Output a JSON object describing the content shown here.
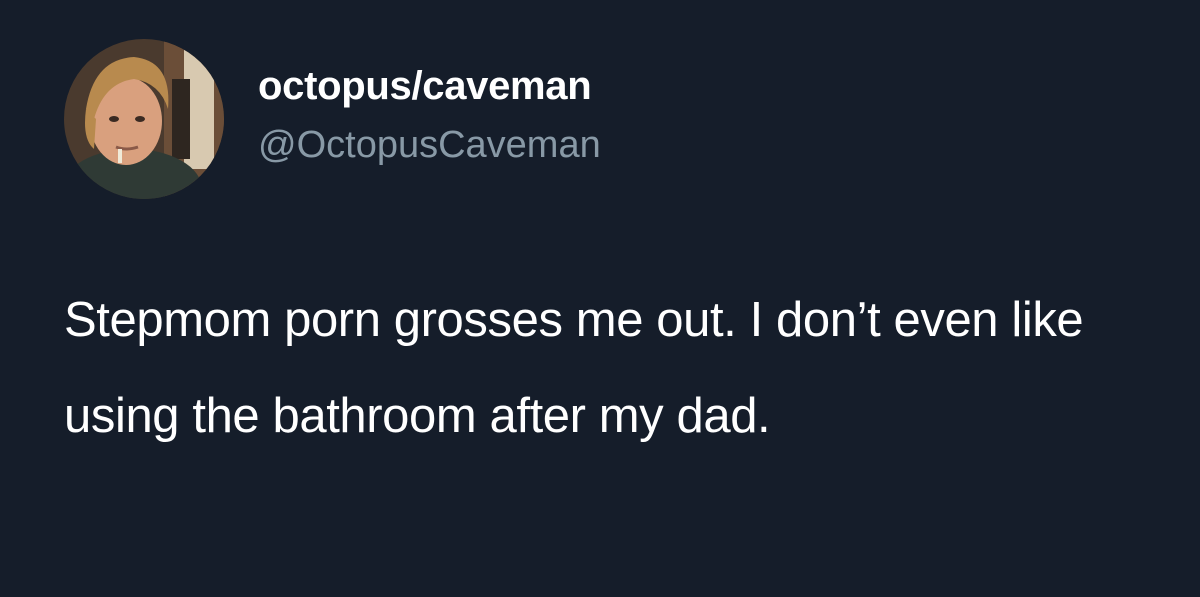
{
  "tweet": {
    "author": {
      "display_name": "octopus/caveman",
      "handle": "@OctopusCaveman",
      "avatar_icon": "profile-photo"
    },
    "text": "Stepmom porn grosses me out. I don’t even like using the bathroom after my dad."
  },
  "colors": {
    "background": "#151d2a",
    "text_primary": "#ffffff",
    "text_secondary": "#8899a6"
  }
}
